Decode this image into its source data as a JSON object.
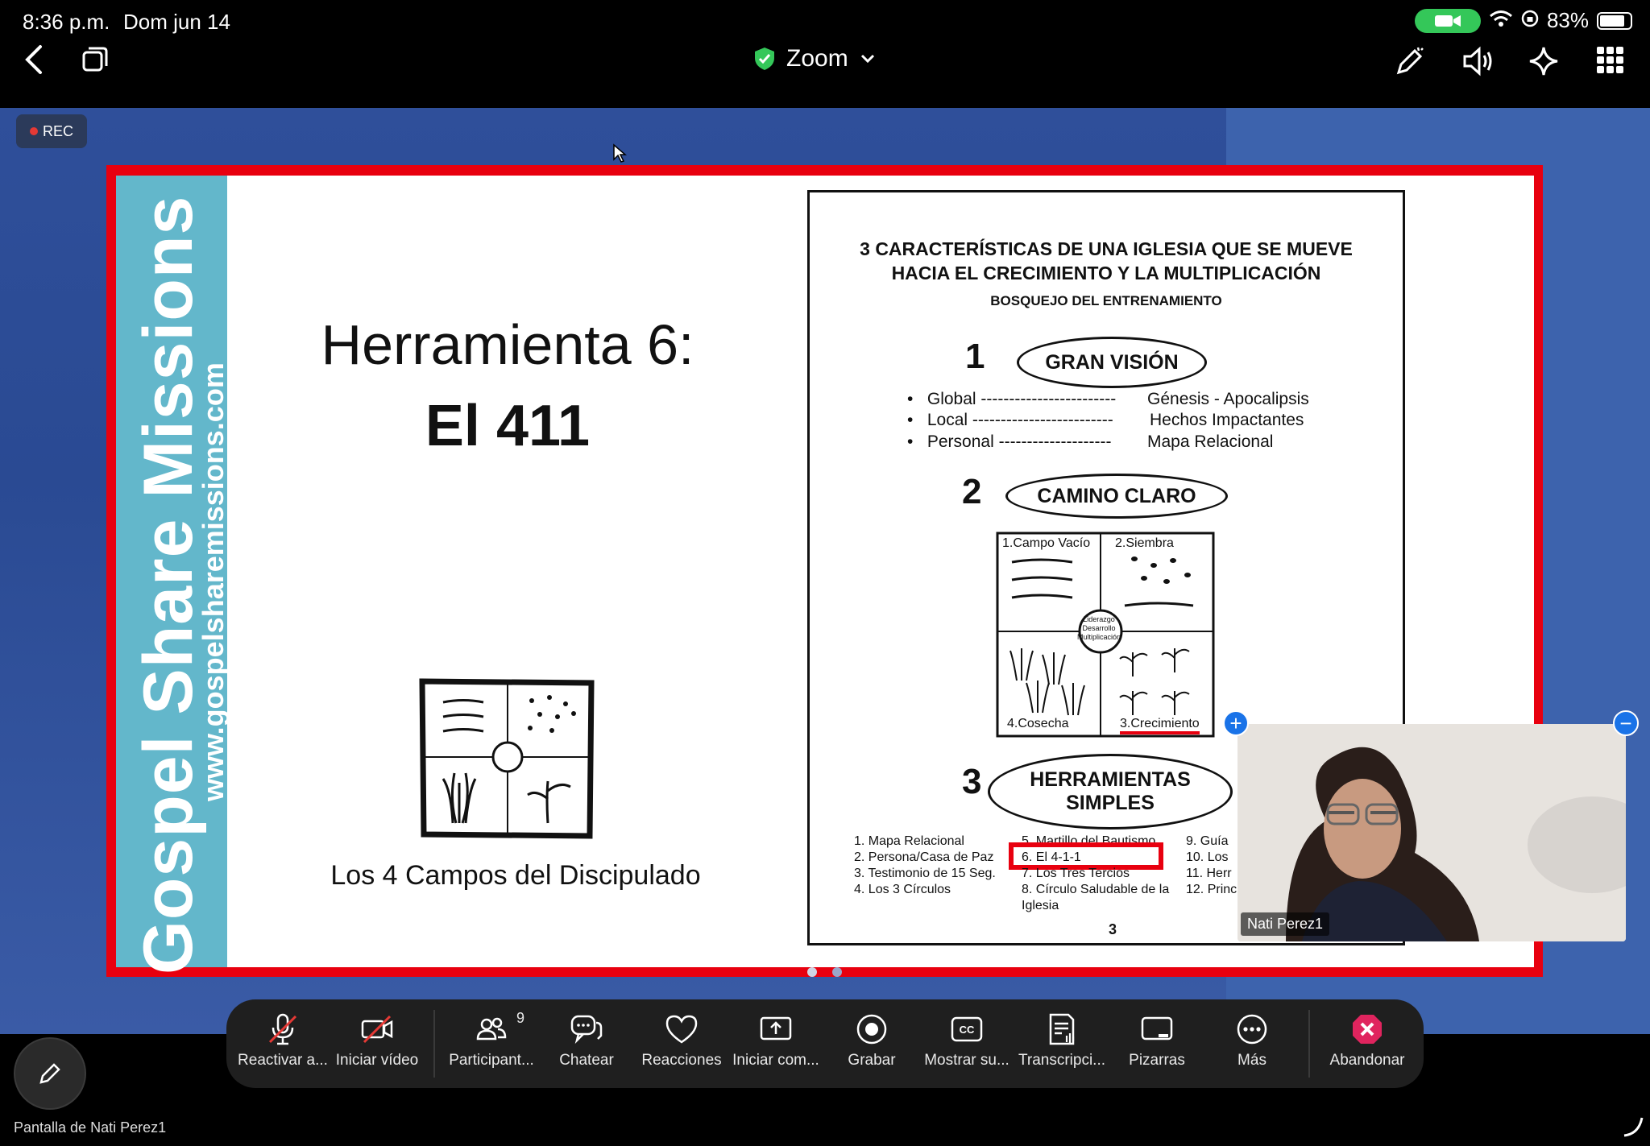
{
  "status_bar": {
    "time": "8:36 p.m.",
    "date": "Dom jun 14",
    "battery": "83%"
  },
  "title_bar": {
    "app_title": "Zoom"
  },
  "meeting": {
    "rec_label": "REC",
    "participant_count": "9",
    "self_view_name": "Nati Perez1",
    "footer_label": "Pantalla de Nati Perez1"
  },
  "slide": {
    "sidebar_brand": "Gospel Share Missions",
    "sidebar_url": "www.gospelsharemissions.com",
    "title_line1": "Herramienta 6:",
    "title_line2": "El 411",
    "caption": "Los 4 Campos del Discipulado"
  },
  "document": {
    "heading_line1": "3 CARACTERÍSTICAS DE UNA IGLESIA QUE SE MUEVE",
    "heading_line2": "HACIA EL CRECIMIENTO Y LA MULTIPLICACIÓN",
    "subheading": "BOSQUEJO DEL ENTRENAMIENTO",
    "section1_num": "1",
    "section1_title": "GRAN VISIÓN",
    "vision_rows": [
      {
        "left": "Global ------------------------",
        "right": "Génesis - Apocalipsis"
      },
      {
        "left": "Local -------------------------",
        "right": "Hechos Impactantes"
      },
      {
        "left": "Personal --------------------",
        "right": "Mapa Relacional"
      }
    ],
    "section2_num": "2",
    "section2_title": "CAMINO CLARO",
    "fields": {
      "q1": "1.Campo Vacío",
      "q2": "2.Siembra",
      "q3": "4.Cosecha",
      "q4": "3.Crecimiento",
      "center": "Liderazgo Desarrollo Multiplicación"
    },
    "section3_num": "3",
    "section3_title_line1": "HERRAMIENTAS",
    "section3_title_line2": "SIMPLES",
    "tools_col1": [
      "1. Mapa Relacional",
      "2. Persona/Casa de Paz",
      "3. Testimonio de 15 Seg.",
      "4. Los 3 Círculos"
    ],
    "tools_col2": [
      "5. Martillo del Bautismo",
      "6. El 4-1-1",
      "7. Los Tres Tercios",
      "8. Círculo Saludable de la",
      "Iglesia"
    ],
    "tools_col3": [
      "9.  Guía",
      "10. Los",
      "11. Herr",
      "12. Princ"
    ],
    "page_number": "3"
  },
  "toolbar": {
    "items": [
      {
        "label": "Reactivar a...",
        "icon": "mic-off-icon"
      },
      {
        "label": "Iniciar vídeo",
        "icon": "video-off-icon"
      },
      {
        "label": "Participant...",
        "icon": "participants-icon"
      },
      {
        "label": "Chatear",
        "icon": "chat-icon"
      },
      {
        "label": "Reacciones",
        "icon": "heart-icon"
      },
      {
        "label": "Iniciar com...",
        "icon": "share-screen-icon"
      },
      {
        "label": "Grabar",
        "icon": "record-icon"
      },
      {
        "label": "Mostrar su...",
        "icon": "cc-icon"
      },
      {
        "label": "Transcripci...",
        "icon": "transcript-icon"
      },
      {
        "label": "Pizarras",
        "icon": "whiteboard-icon"
      },
      {
        "label": "Más",
        "icon": "more-icon"
      },
      {
        "label": "Abandonar",
        "icon": "leave-icon"
      }
    ]
  },
  "colors": {
    "accent_red": "#e8000f",
    "sidebar_teal": "#63b7cb",
    "stage_blue": "#2f4f9a",
    "leave_red": "#e0245e",
    "security_green": "#34c759"
  }
}
